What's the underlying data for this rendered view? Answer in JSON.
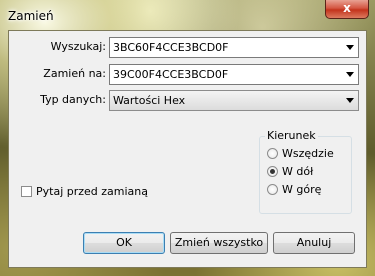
{
  "window": {
    "title": "Zamień",
    "close_label": "x"
  },
  "form": {
    "search_label": "Wyszukaj:",
    "search_value": "3BC60F4CCE3BCD0F",
    "replace_label": "Zamień na:",
    "replace_value": "39C00F4CCE3BCD0F",
    "type_label": "Typ danych:",
    "type_value": "Wartości Hex"
  },
  "direction": {
    "title": "Kierunek",
    "options": [
      "Wszędzie",
      "W dół",
      "W górę"
    ],
    "selected": "W dół"
  },
  "confirm_checkbox": {
    "label": "Pytaj przed zamianą",
    "checked": false
  },
  "buttons": {
    "ok": "OK",
    "replace_all": "Zmień wszystko",
    "cancel": "Anuluj"
  },
  "colors": {
    "close_button": "#c3331c",
    "dialog_bg": "#f0f0f0",
    "default_button_border": "#3c7fb1"
  }
}
